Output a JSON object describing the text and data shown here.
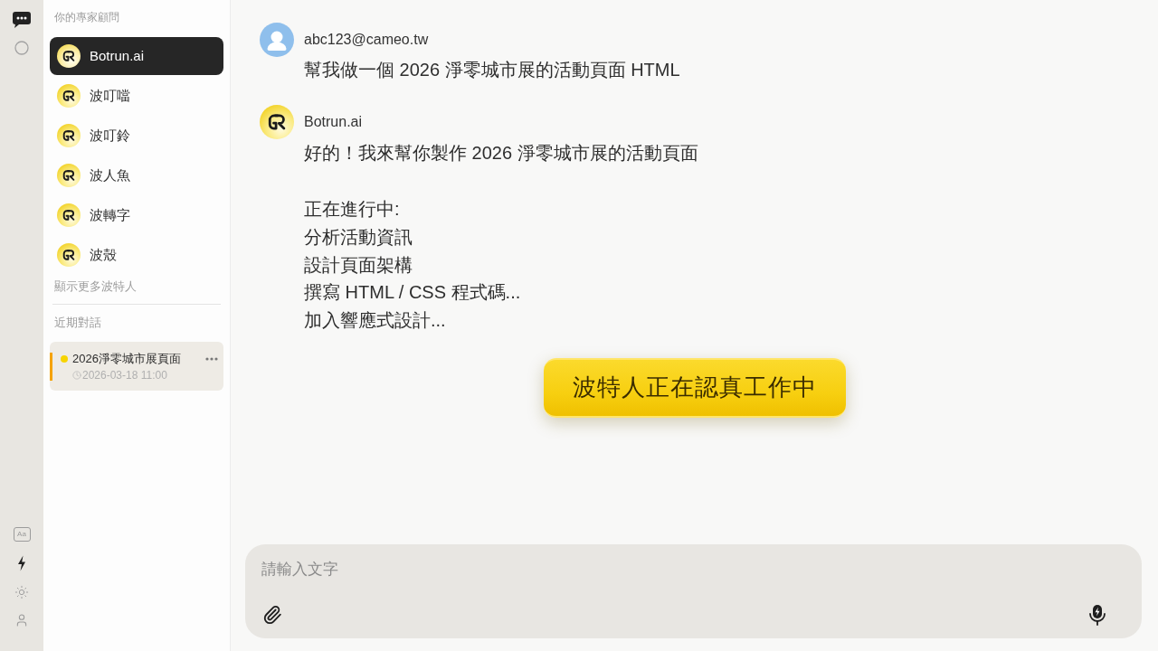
{
  "rail": {
    "nav": [
      {
        "kind": "chat",
        "selected": true
      },
      {
        "kind": "circle",
        "selected": false
      }
    ],
    "tools": [
      {
        "kind": "font",
        "label": "Aa",
        "on": false
      },
      {
        "kind": "bolt",
        "on": true
      },
      {
        "kind": "sun",
        "on": false
      },
      {
        "kind": "user",
        "on": false
      }
    ]
  },
  "sidebar": {
    "experts_heading": "你的專家顧問",
    "experts": [
      {
        "name": "Botrun.ai",
        "selected": true
      },
      {
        "name": "波叮噹",
        "selected": false
      },
      {
        "name": "波叮鈴",
        "selected": false
      },
      {
        "name": "波人魚",
        "selected": false
      },
      {
        "name": "波轉字",
        "selected": false
      },
      {
        "name": "波殼",
        "selected": false
      }
    ],
    "show_more": "顯示更多波特人",
    "recent_heading": "近期對話",
    "conversations": [
      {
        "title": "2026淨零城市展頁面",
        "time": "2026-03-18 11:00",
        "selected": true
      }
    ]
  },
  "messages": [
    {
      "kind": "user",
      "author": "abc123@cameo.tw",
      "paragraphs": [
        [
          "幫我做一個 2026 淨零城市展的活動頁面 HTML"
        ]
      ]
    },
    {
      "kind": "bot",
      "author": "Botrun.ai",
      "paragraphs": [
        [
          "好的！我來幫你製作 2026 淨零城市展的活動頁面"
        ],
        [
          "正在進行中:",
          "分析活動資訊",
          "設計頁面架構",
          "撰寫 HTML / CSS 程式碼...",
          "加入響應式設計..."
        ]
      ]
    }
  ],
  "status_button": {
    "label": "波特人正在認真工作中"
  },
  "composer": {
    "placeholder": "請輸入文字"
  }
}
